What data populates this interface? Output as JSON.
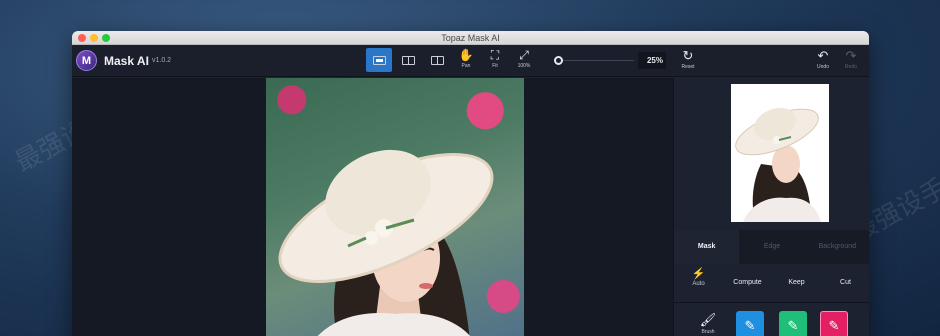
{
  "window": {
    "title": "Topaz Mask AI"
  },
  "app": {
    "logo_letter": "M",
    "name": "Mask AI",
    "version": "v1.0.2"
  },
  "toolbar": {
    "pan": "Pan",
    "fit": "Fit",
    "zoom_100": "100%",
    "zoom_value": "25%",
    "reset": "Reset",
    "undo": "Undo",
    "redo": "Redo"
  },
  "panel": {
    "tabs": [
      "Mask",
      "Edge",
      "Background"
    ],
    "active_tab": "Mask",
    "modes": {
      "auto": "Auto",
      "compute": "Compute",
      "keep": "Keep",
      "cut": "Cut"
    },
    "brush": "Brush"
  },
  "colors": {
    "active_view": "#2a77c9",
    "compute_chip": "#1e8fe1",
    "keep_chip": "#1fbf7a",
    "cut_chip": "#e41f63"
  },
  "watermark": "最强设手",
  "icons": [
    "logo-icon",
    "single-view-icon",
    "split-view-icon",
    "side-by-side-icon",
    "pan-icon",
    "fit-icon",
    "zoom-100-icon",
    "reset-icon",
    "undo-icon",
    "redo-icon",
    "auto-icon",
    "brush-icon"
  ]
}
